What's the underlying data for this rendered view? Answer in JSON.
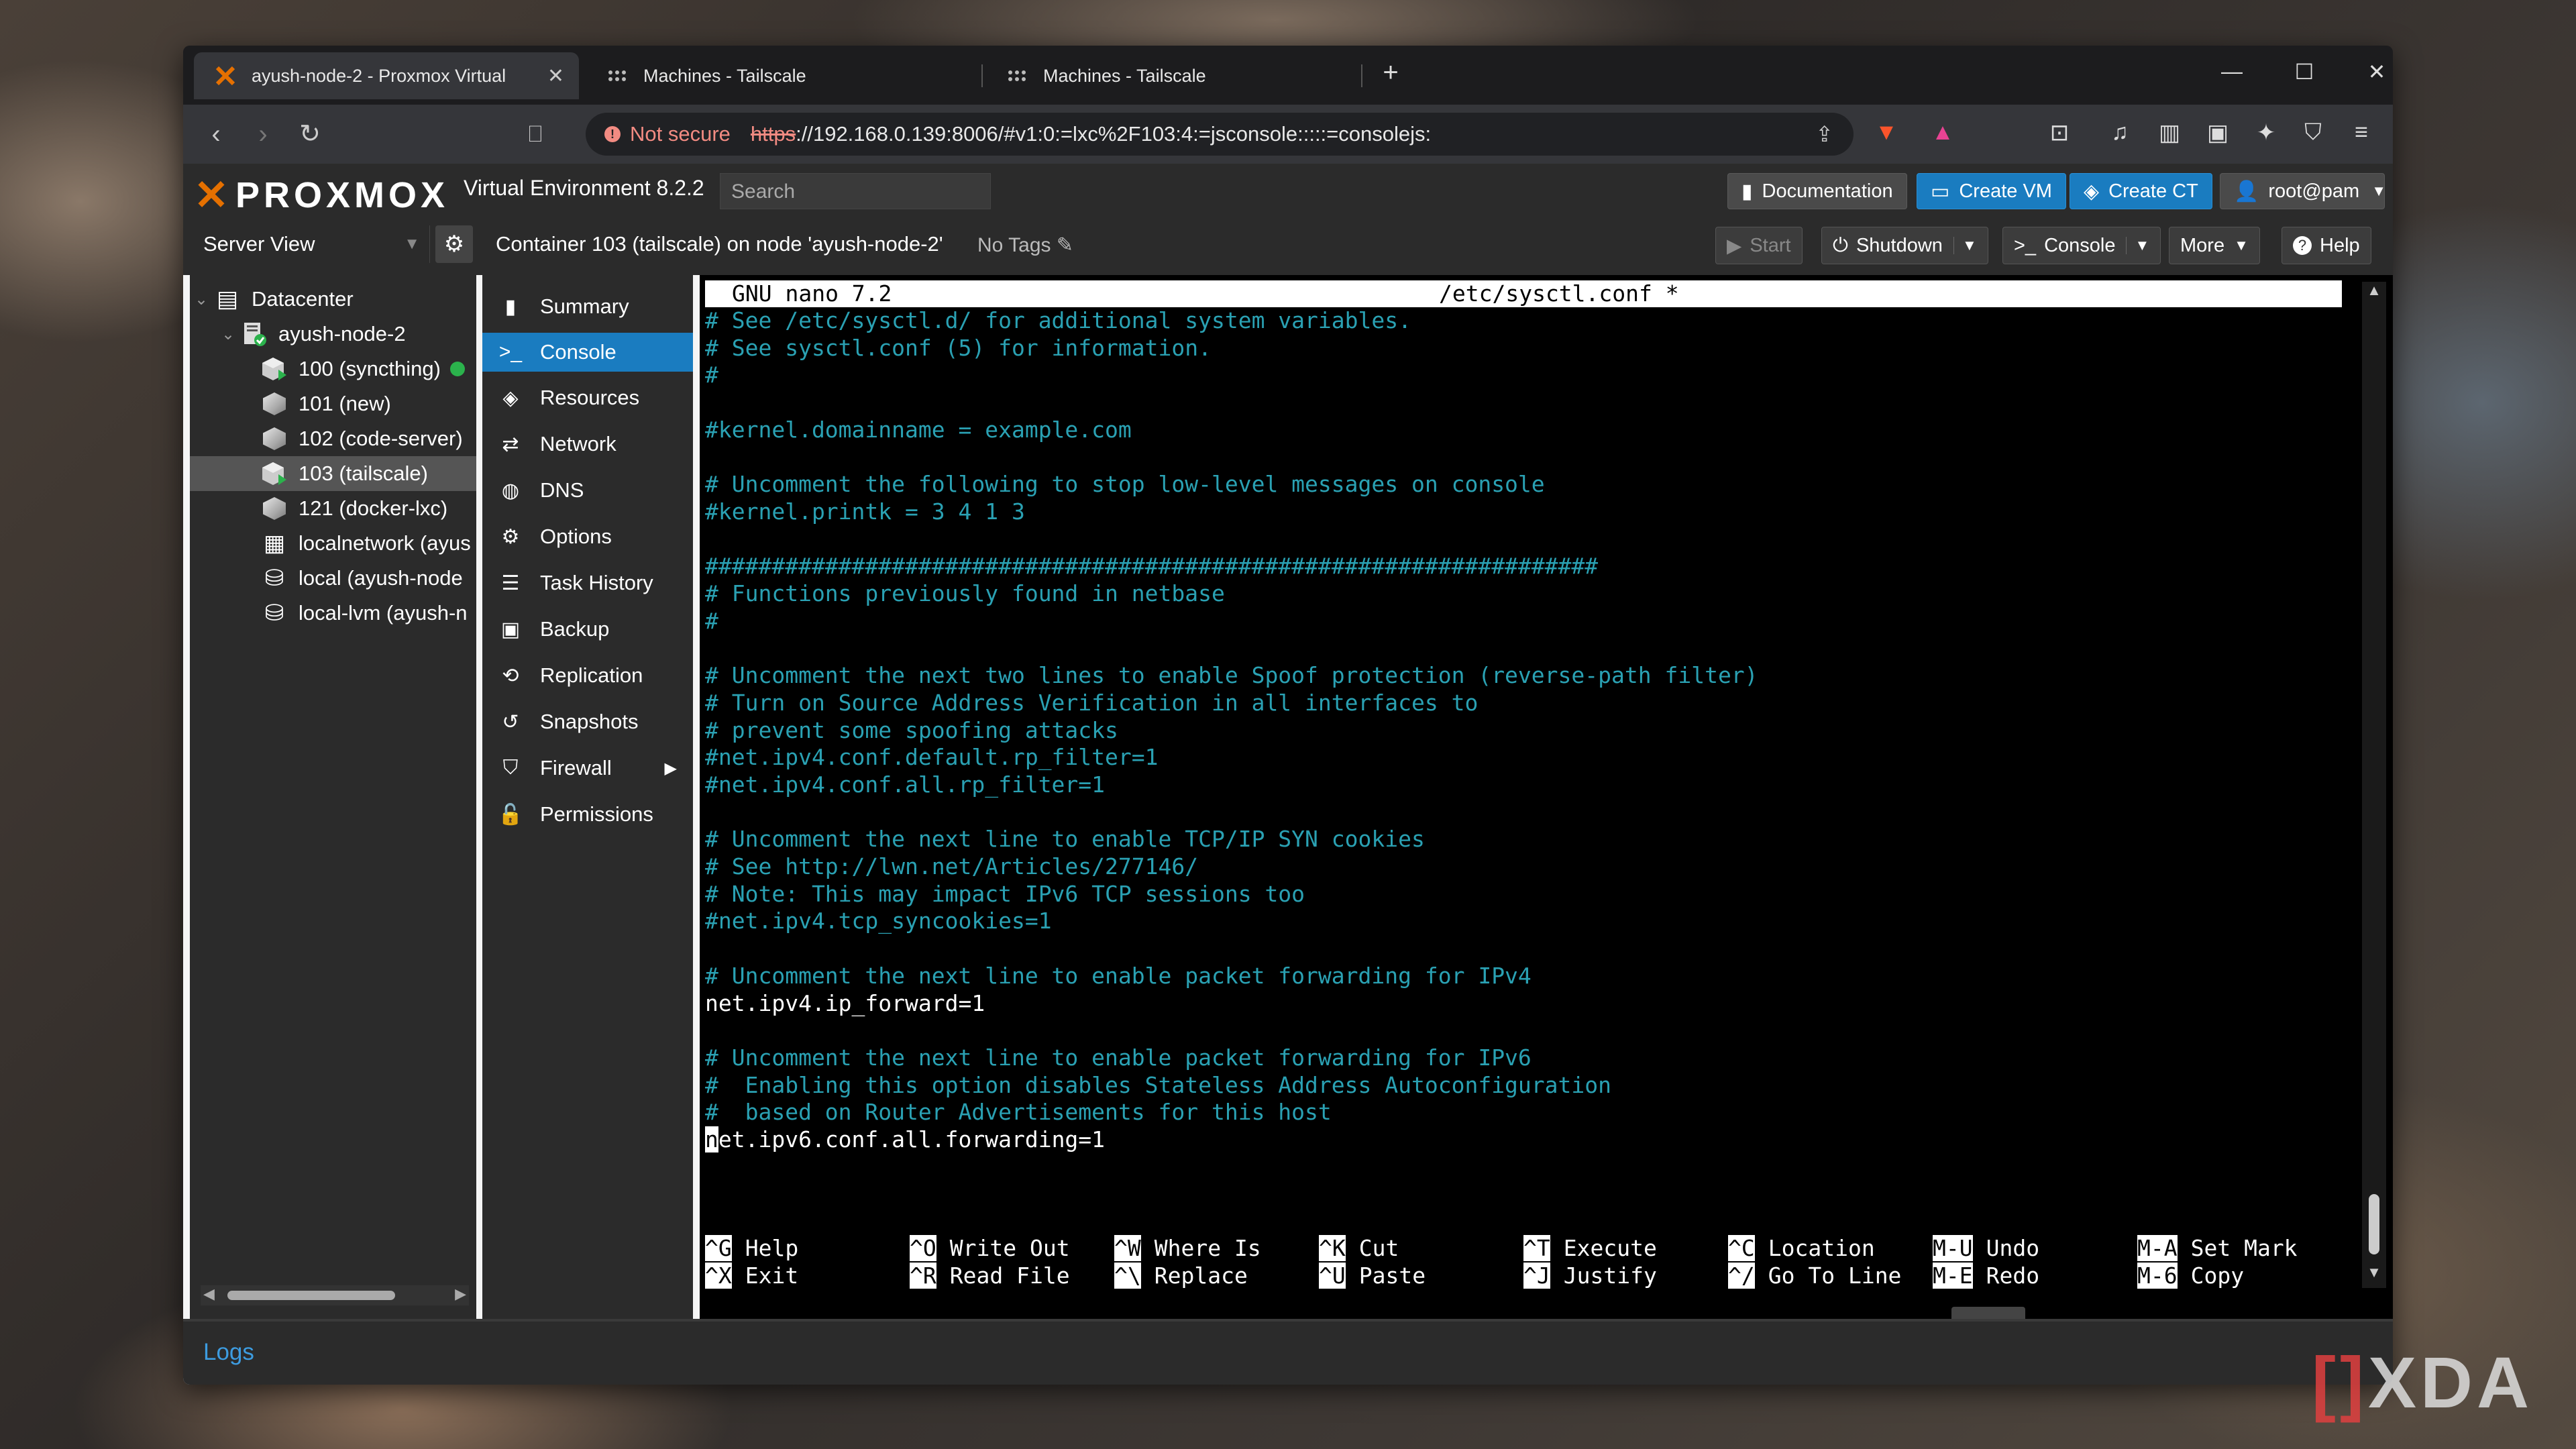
{
  "browser": {
    "tabs": [
      {
        "label": "ayush-node-2 - Proxmox Virtual",
        "active": true
      },
      {
        "label": "Machines - Tailscale",
        "active": false
      },
      {
        "label": "Machines - Tailscale",
        "active": false
      }
    ],
    "not_secure": "Not secure",
    "url_scheme": "https",
    "url_rest": "://192.168.0.139:8006/#v1:0:=lxc%2F103:4:=jsconsole:::::=consolejs:"
  },
  "header": {
    "logo": "PROXMOX",
    "version": "Virtual Environment 8.2.2",
    "search_placeholder": "Search",
    "documentation": "Documentation",
    "create_vm": "Create VM",
    "create_ct": "Create CT",
    "user": "root@pam"
  },
  "sub": {
    "server_view": "Server View",
    "container_title": "Container 103 (tailscale) on node 'ayush-node-2'",
    "no_tags": "No Tags",
    "start": "Start",
    "shutdown": "Shutdown",
    "console": "Console",
    "more": "More",
    "help": "Help"
  },
  "tree": [
    {
      "label": "Datacenter"
    },
    {
      "label": "ayush-node-2"
    },
    {
      "label": "100 (syncthing)"
    },
    {
      "label": "101 (new)"
    },
    {
      "label": "102 (code-server)"
    },
    {
      "label": "103 (tailscale)"
    },
    {
      "label": "121 (docker-lxc)"
    },
    {
      "label": "localnetwork (ayus"
    },
    {
      "label": "local (ayush-node"
    },
    {
      "label": "local-lvm (ayush-n"
    }
  ],
  "menu": [
    {
      "label": "Summary",
      "icon": "book-icon"
    },
    {
      "label": "Console",
      "icon": "terminal-icon"
    },
    {
      "label": "Resources",
      "icon": "cube-icon"
    },
    {
      "label": "Network",
      "icon": "exchange-icon"
    },
    {
      "label": "DNS",
      "icon": "globe-icon"
    },
    {
      "label": "Options",
      "icon": "gear-icon"
    },
    {
      "label": "Task History",
      "icon": "list-icon"
    },
    {
      "label": "Backup",
      "icon": "floppy-icon"
    },
    {
      "label": "Replication",
      "icon": "retweet-icon"
    },
    {
      "label": "Snapshots",
      "icon": "history-icon"
    },
    {
      "label": "Firewall",
      "icon": "shield-icon"
    },
    {
      "label": "Permissions",
      "icon": "unlock-icon"
    }
  ],
  "terminal": {
    "nano_version": "GNU nano 7.2",
    "filename": "/etc/sysctl.conf *",
    "lines": [
      {
        "t": "# See /etc/sysctl.d/ for additional system variables.",
        "c": 1
      },
      {
        "t": "# See sysctl.conf (5) for information.",
        "c": 1
      },
      {
        "t": "#",
        "c": 1
      },
      {
        "t": "",
        "c": 0
      },
      {
        "t": "#kernel.domainname = example.com",
        "c": 1
      },
      {
        "t": "",
        "c": 0
      },
      {
        "t": "# Uncomment the following to stop low-level messages on console",
        "c": 1
      },
      {
        "t": "#kernel.printk = 3 4 1 3",
        "c": 1
      },
      {
        "t": "",
        "c": 0
      },
      {
        "t": "###################################################################",
        "c": 1
      },
      {
        "t": "# Functions previously found in netbase",
        "c": 1
      },
      {
        "t": "#",
        "c": 1
      },
      {
        "t": "",
        "c": 0
      },
      {
        "t": "# Uncomment the next two lines to enable Spoof protection (reverse-path filter)",
        "c": 1
      },
      {
        "t": "# Turn on Source Address Verification in all interfaces to",
        "c": 1
      },
      {
        "t": "# prevent some spoofing attacks",
        "c": 1
      },
      {
        "t": "#net.ipv4.conf.default.rp_filter=1",
        "c": 1
      },
      {
        "t": "#net.ipv4.conf.all.rp_filter=1",
        "c": 1
      },
      {
        "t": "",
        "c": 0
      },
      {
        "t": "# Uncomment the next line to enable TCP/IP SYN cookies",
        "c": 1
      },
      {
        "t": "# See http://lwn.net/Articles/277146/",
        "c": 1
      },
      {
        "t": "# Note: This may impact IPv6 TCP sessions too",
        "c": 1
      },
      {
        "t": "#net.ipv4.tcp_syncookies=1",
        "c": 1
      },
      {
        "t": "",
        "c": 0
      },
      {
        "t": "# Uncomment the next line to enable packet forwarding for IPv4",
        "c": 1
      },
      {
        "t": "net.ipv4.ip_forward=1",
        "c": 0
      },
      {
        "t": "",
        "c": 0
      },
      {
        "t": "# Uncomment the next line to enable packet forwarding for IPv6",
        "c": 1
      },
      {
        "t": "#  Enabling this option disables Stateless Address Autoconfiguration",
        "c": 1
      },
      {
        "t": "#  based on Router Advertisements for this host",
        "c": 1
      },
      {
        "t": "et.ipv6.conf.all.forwarding=1",
        "c": 0,
        "cursor": "n"
      }
    ],
    "shortcuts": [
      {
        "k1": "^G",
        "l1": "Help",
        "k2": "^X",
        "l2": "Exit"
      },
      {
        "k1": "^O",
        "l1": "Write Out",
        "k2": "^R",
        "l2": "Read File"
      },
      {
        "k1": "^W",
        "l1": "Where Is",
        "k2": "^\\",
        "l2": "Replace"
      },
      {
        "k1": "^K",
        "l1": "Cut",
        "k2": "^U",
        "l2": "Paste"
      },
      {
        "k1": "^T",
        "l1": "Execute",
        "k2": "^J",
        "l2": "Justify"
      },
      {
        "k1": "^C",
        "l1": "Location",
        "k2": "^/",
        "l2": "Go To Line"
      },
      {
        "k1": "M-U",
        "l1": "Undo",
        "k2": "M-E",
        "l2": "Redo"
      },
      {
        "k1": "M-A",
        "l1": "Set Mark",
        "k2": "M-6",
        "l2": "Copy"
      }
    ]
  },
  "logs": "Logs",
  "watermark": {
    "a": "[",
    "b": "]",
    "c": "XDA"
  }
}
